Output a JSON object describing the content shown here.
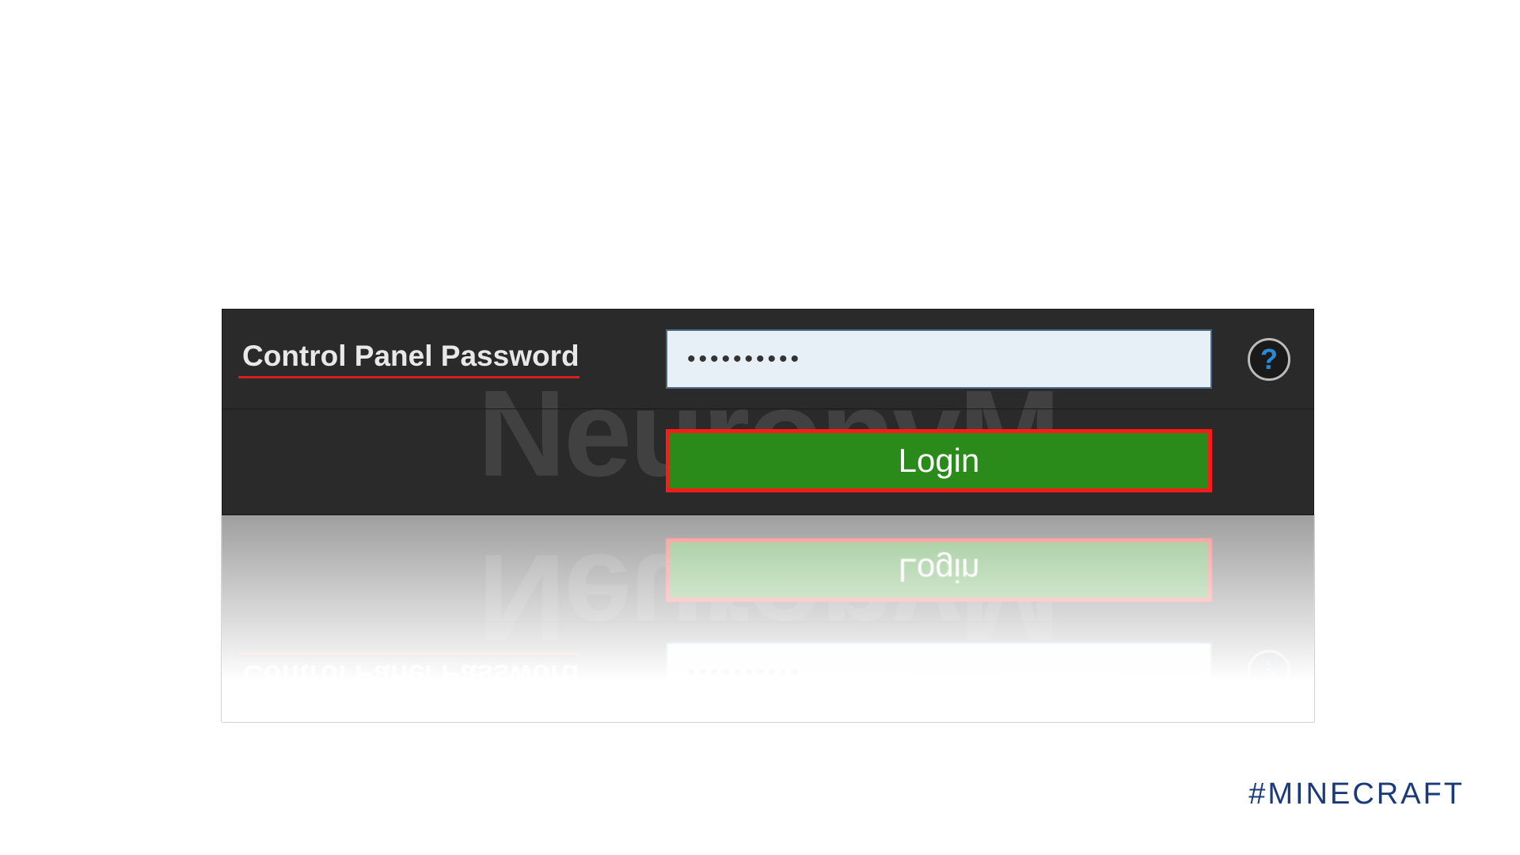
{
  "panel": {
    "label": "Control Panel Password",
    "password_value": "••••••••••",
    "login_label": "Login",
    "help_symbol": "?"
  },
  "watermark": "NeuronvM",
  "hashtag": "#MINECRAFT"
}
